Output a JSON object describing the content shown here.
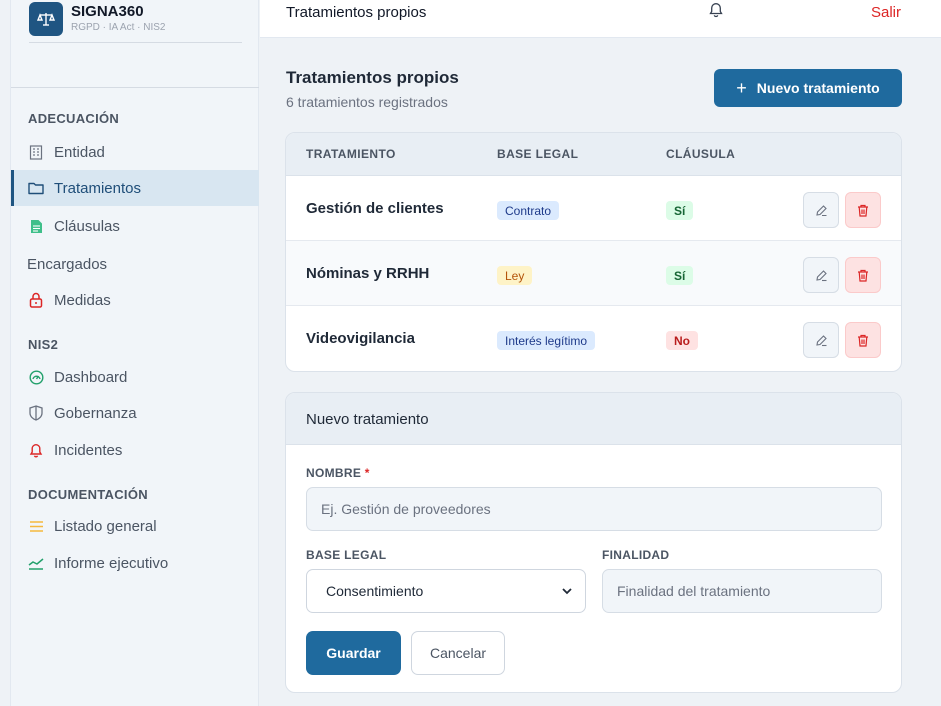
{
  "brand": {
    "logo_text": "⚖",
    "name": "SIGNA360",
    "subtitle": "RGPD · IA Act · NIS2"
  },
  "sidebar": {
    "sections": [
      {
        "title": "ADECUACIÓN"
      },
      {
        "title": "NIS2"
      },
      {
        "title": "DOCUMENTACIÓN"
      }
    ],
    "items": [
      {
        "label": "Entidad",
        "icon": "building-icon"
      },
      {
        "label": "Tratamientos",
        "icon": "folder-icon",
        "active": true
      },
      {
        "label": "Cláusulas",
        "icon": "document-icon"
      },
      {
        "label": "Encargados",
        "icon": ""
      },
      {
        "label": "Medidas",
        "icon": "lock-icon"
      },
      {
        "label": "Dashboard",
        "icon": "gauge-icon"
      },
      {
        "label": "Gobernanza",
        "icon": "shield-icon"
      },
      {
        "label": "Incidentes",
        "icon": "bell-icon"
      },
      {
        "label": "Listado general",
        "icon": "list-icon"
      },
      {
        "label": "Informe ejecutivo",
        "icon": "chart-line-icon"
      }
    ]
  },
  "topbar": {
    "title": "Tratamientos propios",
    "logout_label": "Salir"
  },
  "main": {
    "title": "Tratamientos propios",
    "subtitle": "6 tratamientos registrados",
    "new_button_label": "Nuevo tratamiento",
    "new_button_icon": "+"
  },
  "table": {
    "headers": [
      "TRATAMIENTO",
      "BASE LEGAL",
      "CLÁUSULA"
    ],
    "rows": [
      {
        "name": "Gestión de clientes",
        "base_legal": "Contrato",
        "clausula": "Sí"
      },
      {
        "name": "Nóminas y RRHH",
        "base_legal": "Ley",
        "clausula": "Sí"
      },
      {
        "name": "Videovigilancia",
        "base_legal": "Interés legítimo",
        "clausula": "No"
      }
    ]
  },
  "form": {
    "title": "Nuevo tratamiento",
    "nombre_label": "NOMBRE",
    "required_mark": "*",
    "nombre_placeholder": "Ej. Gestión de proveedores",
    "base_legal_label": "BASE LEGAL",
    "base_legal_value": "Consentimiento",
    "finalidad_label": "FINALIDAD",
    "finalidad_placeholder": "Finalidad del tratamiento",
    "save_label": "Guardar",
    "cancel_label": "Cancelar"
  },
  "colors": {
    "primary": "#1f6a9e",
    "danger": "#dc2626",
    "sidebar_bg": "#f1f5f9"
  }
}
